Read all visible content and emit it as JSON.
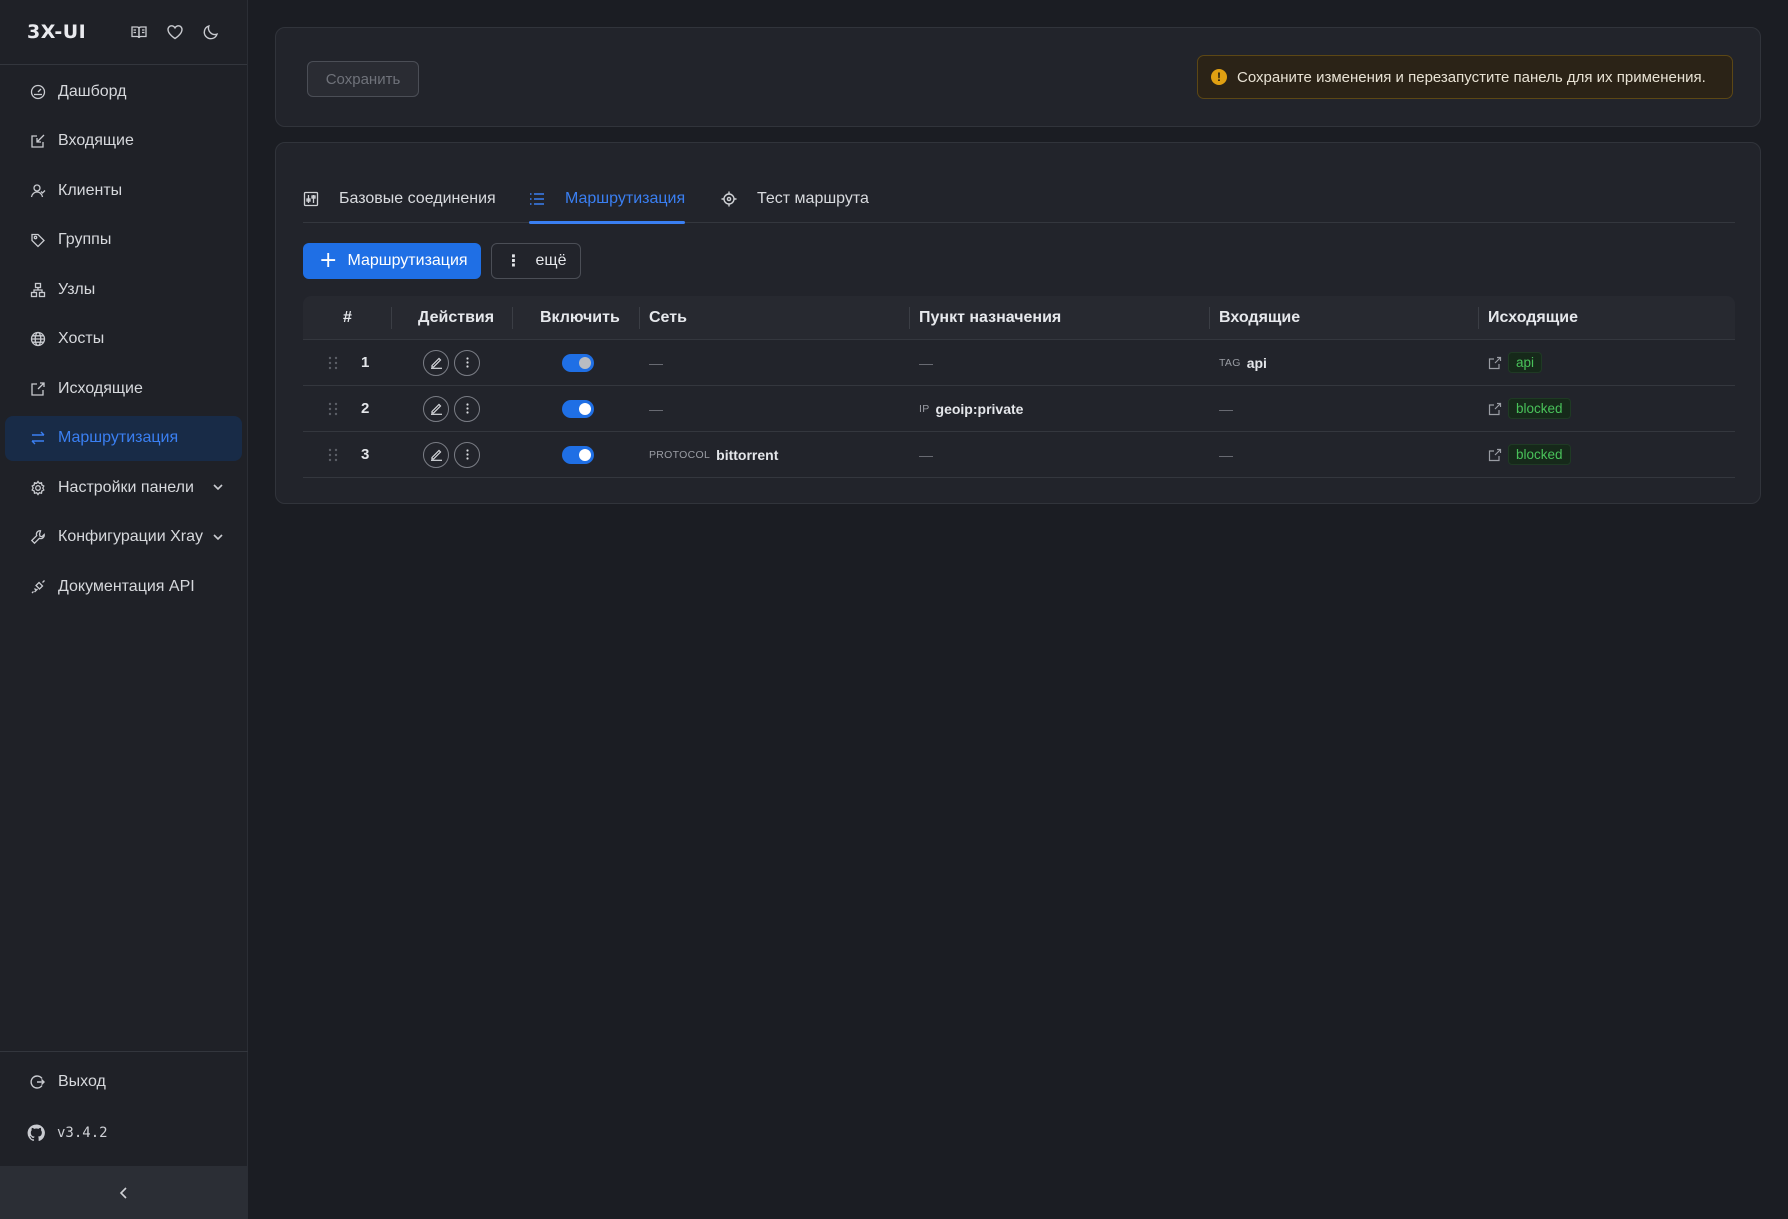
{
  "brand": {
    "title": "3X-UI"
  },
  "sidebar": {
    "items": [
      {
        "label": "Дашборд",
        "icon": "dashboard-icon"
      },
      {
        "label": "Входящие",
        "icon": "inbound-icon"
      },
      {
        "label": "Клиенты",
        "icon": "clients-icon"
      },
      {
        "label": "Группы",
        "icon": "tag-icon"
      },
      {
        "label": "Узлы",
        "icon": "nodes-icon"
      },
      {
        "label": "Хосты",
        "icon": "globe-icon"
      },
      {
        "label": "Исходящие",
        "icon": "outbound-icon"
      },
      {
        "label": "Маршрутизация",
        "icon": "routing-icon",
        "active": true
      },
      {
        "label": "Настройки панели",
        "icon": "gear-icon",
        "expandable": true
      },
      {
        "label": "Конфигурации Xray",
        "icon": "wrench-icon",
        "expandable": true
      },
      {
        "label": "Документация API",
        "icon": "api-icon"
      }
    ],
    "logout_label": "Выход",
    "version": "v3.4.2"
  },
  "toolbar": {
    "save_label": "Сохранить",
    "alert_text": "Сохраните изменения и перезапустите панель для их применения."
  },
  "tabs": [
    {
      "label": "Базовые соединения"
    },
    {
      "label": "Маршрутизация",
      "active": true
    },
    {
      "label": "Тест маршрута"
    }
  ],
  "actions": {
    "add_label": "Маршрутизация",
    "more_label": "ещё"
  },
  "table": {
    "headers": [
      "#",
      "Действия",
      "Включить",
      "Сеть",
      "Пункт назначения",
      "Входящие",
      "Исходящие"
    ],
    "empty": "—",
    "rows": [
      {
        "num": "1",
        "enabled": true,
        "network": "",
        "dest_label": "",
        "dest_value": "",
        "inbound_label": "TAG",
        "inbound_value": "api",
        "outbound": "api"
      },
      {
        "num": "2",
        "enabled": true,
        "network": "",
        "dest_label": "IP",
        "dest_value": "geoip:private",
        "inbound_label": "",
        "inbound_value": "",
        "outbound": "blocked"
      },
      {
        "num": "3",
        "enabled": true,
        "network_label": "PROTOCOL",
        "network": "bittorrent",
        "dest_label": "",
        "dest_value": "",
        "inbound_label": "",
        "inbound_value": "",
        "outbound": "blocked"
      }
    ]
  },
  "colors": {
    "accent": "#3a7ff2",
    "primary_button": "#1f6fe5",
    "warning": "#e0a012",
    "success": "#49c25a"
  }
}
